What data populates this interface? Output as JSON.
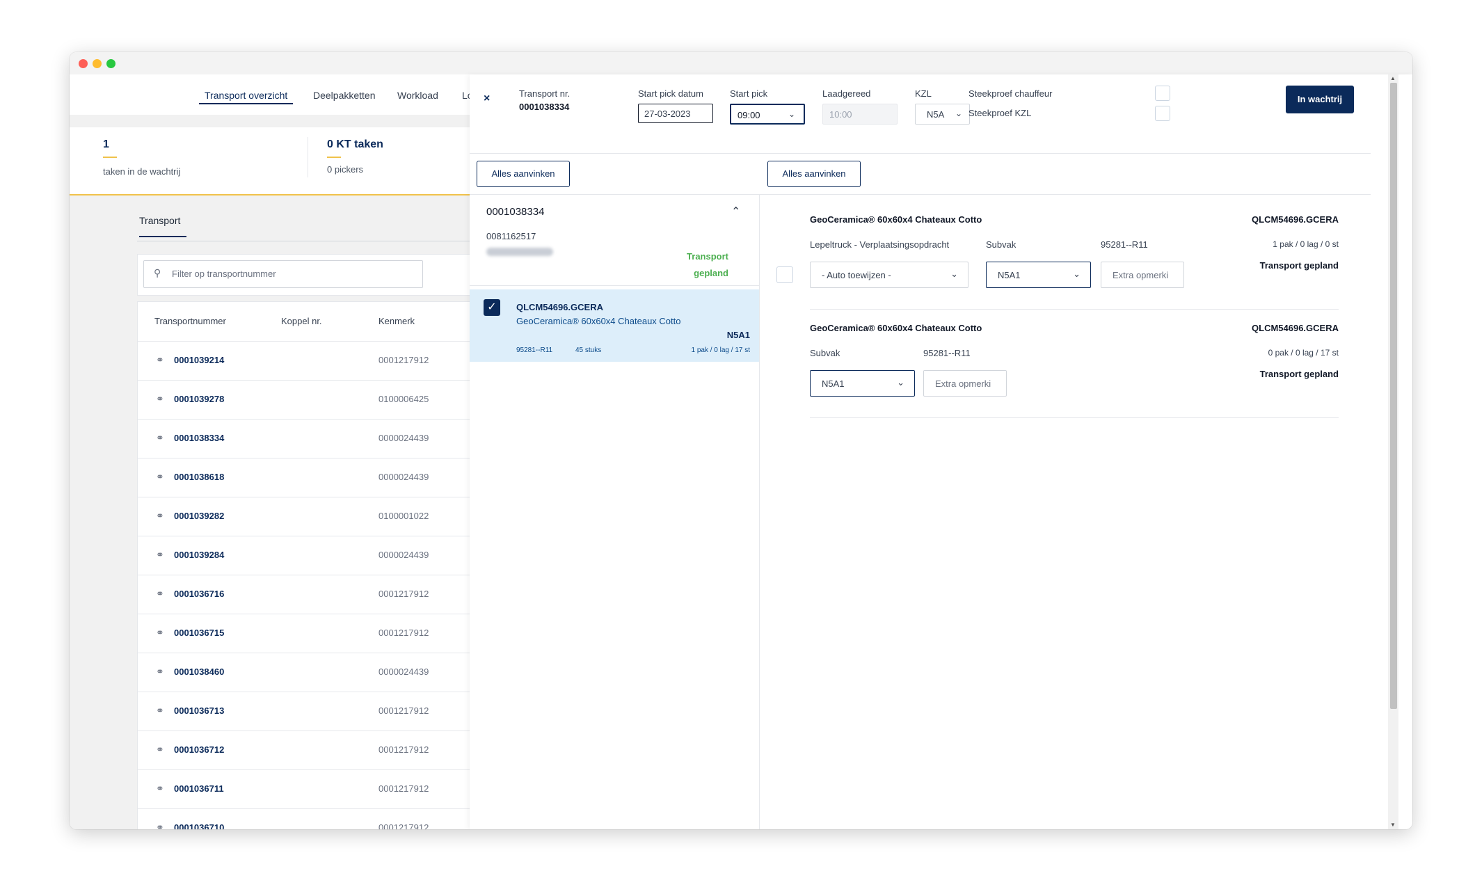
{
  "nav": {
    "tabs": [
      "Transport overzicht",
      "Deelpakketten",
      "Workload",
      "Lo"
    ]
  },
  "stats": {
    "queue_value": "1",
    "queue_label": "taken in de wachtrij",
    "kt_value": "0 KT taken",
    "kt_label": "0 pickers"
  },
  "transport_tab": "Transport",
  "filter": {
    "placeholder": "Filter op transportnummer"
  },
  "table": {
    "headers": [
      "Transportnummer",
      "Koppel nr.",
      "Kenmerk"
    ],
    "rows": [
      {
        "number": "0001039214",
        "kenmerk": "0001217912"
      },
      {
        "number": "0001039278",
        "kenmerk": "0100006425"
      },
      {
        "number": "0001038334",
        "kenmerk": "0000024439"
      },
      {
        "number": "0001038618",
        "kenmerk": "0000024439"
      },
      {
        "number": "0001039282",
        "kenmerk": "0100001022"
      },
      {
        "number": "0001039284",
        "kenmerk": "0000024439"
      },
      {
        "number": "0001036716",
        "kenmerk": "0001217912"
      },
      {
        "number": "0001036715",
        "kenmerk": "0001217912"
      },
      {
        "number": "0001038460",
        "kenmerk": "0000024439"
      },
      {
        "number": "0001036713",
        "kenmerk": "0001217912"
      },
      {
        "number": "0001036712",
        "kenmerk": "0001217912"
      },
      {
        "number": "0001036711",
        "kenmerk": "0001217912"
      },
      {
        "number": "0001036710",
        "kenmerk": "0001217912"
      }
    ]
  },
  "panel": {
    "close_icon": "×",
    "transport_label": "Transport nr.",
    "transport_value": "0001038334",
    "start_pick_datum_label": "Start pick datum",
    "start_pick_datum_value": "27-03-2023",
    "start_pick_label": "Start pick",
    "start_pick_value": "09:00",
    "laadgereed_label": "Laadgereed",
    "laadgereed_placeholder": "10:00",
    "kzl_label": "KZL",
    "kzl_value": "N5A",
    "steekproef_chauffeur_label": "Steekproef chauffeur",
    "steekproef_kzl_label": "Steekproef KZL",
    "queue_button": "In wachtrij",
    "check_all_left": "Alles aanvinken",
    "check_all_right": "Alles aanvinken"
  },
  "group": {
    "title": "0001038334",
    "subtitle": "0081162517",
    "status_line1": "Transport",
    "status_line2": "gepland"
  },
  "item": {
    "code": "QLCM54696.GCERA",
    "name": "GeoCeramica® 60x60x4 Chateaux Cotto",
    "location": "N5A1",
    "ref": "95281--R11",
    "count": "45 stuks",
    "qty": "1 pak / 0 lag / 17 st"
  },
  "cards": [
    {
      "title": "GeoCeramica® 60x60x4 Chateaux Cotto",
      "code": "QLCM54696.GCERA",
      "order_label": "Lepeltruck - Verplaatsingsopdracht",
      "order_value": "- Auto toewijzen -",
      "subvak_label": "Subvak",
      "subvak_value": "N5A1",
      "ref": "95281--R11",
      "extra_placeholder": "Extra opmerki",
      "qty": "1 pak / 0 lag / 0 st",
      "status": "Transport gepland"
    },
    {
      "title": "GeoCeramica® 60x60x4 Chateaux Cotto",
      "code": "QLCM54696.GCERA",
      "subvak_label": "Subvak",
      "subvak_value": "N5A1",
      "ref": "95281--R11",
      "extra_placeholder": "Extra opmerki",
      "qty": "0 pak / 0 lag / 17 st",
      "status": "Transport gepland"
    }
  ]
}
